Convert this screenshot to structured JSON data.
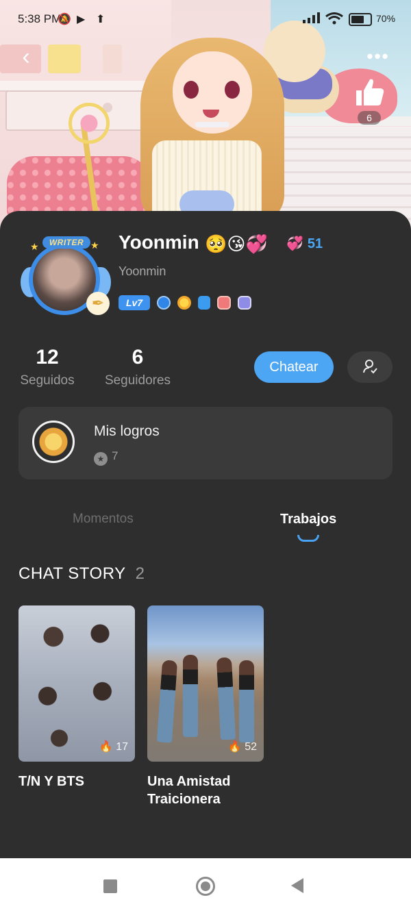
{
  "status_bar": {
    "time": "5:38 PM",
    "battery": "70%"
  },
  "hero": {
    "like_count": "6"
  },
  "profile": {
    "badge_label": "WRITER",
    "name": "Yoonmin",
    "name_emojis": "🥺😘💞",
    "heart_count": "51",
    "username": "Yoonmin",
    "level": "Lv7"
  },
  "stats": {
    "following_count": "12",
    "following_label": "Seguidos",
    "followers_count": "6",
    "followers_label": "Seguidores"
  },
  "actions": {
    "chat_label": "Chatear"
  },
  "achievements": {
    "title": "Mis logros",
    "count": "7"
  },
  "tabs": [
    {
      "label": "Momentos",
      "active": false
    },
    {
      "label": "Trabajos",
      "active": true
    }
  ],
  "section": {
    "title": "CHAT STORY",
    "count": "2"
  },
  "stories": [
    {
      "title": "T/N Y BTS",
      "views": "17"
    },
    {
      "title": "Una Amistad Traicionera",
      "views": "52"
    }
  ],
  "colors": {
    "accent": "#4da6f4",
    "card_bg": "#2e2e2e",
    "heart": "#ec6f88"
  },
  "icons": [
    "back-icon",
    "more-icon",
    "like-icon",
    "follow-user-icon",
    "medal-icon",
    "star-icon",
    "flame-icon"
  ]
}
